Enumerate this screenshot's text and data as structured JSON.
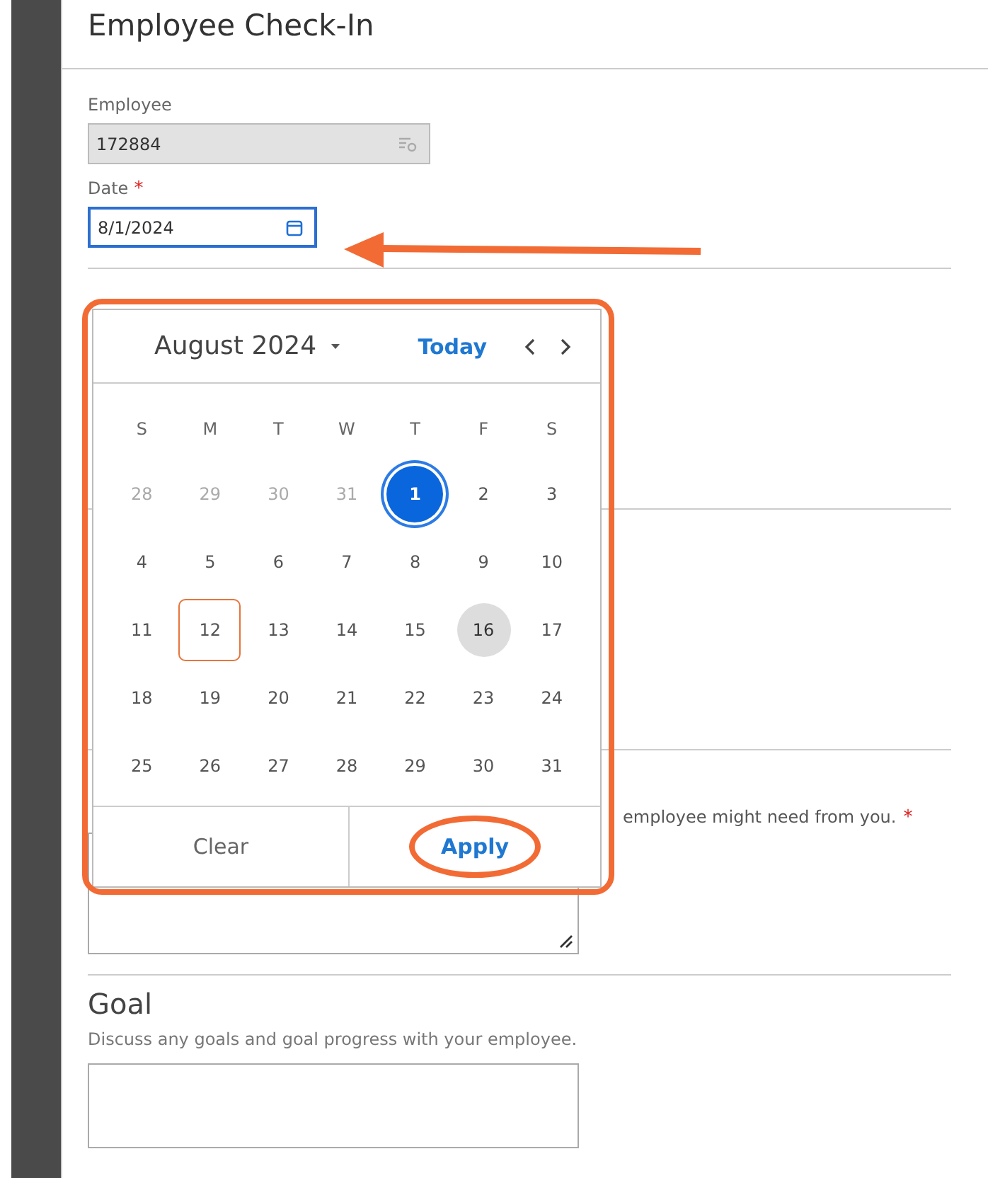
{
  "page": {
    "title": "Employee Check-In"
  },
  "fields": [
    {
      "label": "Employee",
      "value": "172884",
      "required": false,
      "disabled": true,
      "focused": false
    },
    {
      "label": "Date",
      "value": "8/1/2024",
      "required": true,
      "required_mark": "*",
      "disabled": false,
      "focused": true
    }
  ],
  "calendar": {
    "month_label": "August 2024",
    "today_label": "Today",
    "highlighted": true,
    "weekdays": [
      "S",
      "M",
      "T",
      "W",
      "T",
      "F",
      "S"
    ],
    "weeks": [
      [
        {
          "day": "28",
          "outside": true,
          "selected": false,
          "today": false,
          "marked": false
        },
        {
          "day": "29",
          "outside": true,
          "selected": false,
          "today": false,
          "marked": false
        },
        {
          "day": "30",
          "outside": true,
          "selected": false,
          "today": false,
          "marked": false
        },
        {
          "day": "31",
          "outside": true,
          "selected": false,
          "today": false,
          "marked": false
        },
        {
          "day": "1",
          "outside": false,
          "selected": true,
          "today": false,
          "marked": false
        },
        {
          "day": "2",
          "outside": false,
          "selected": false,
          "today": false,
          "marked": false
        },
        {
          "day": "3",
          "outside": false,
          "selected": false,
          "today": false,
          "marked": false
        }
      ],
      [
        {
          "day": "4",
          "outside": false,
          "selected": false,
          "today": false,
          "marked": false
        },
        {
          "day": "5",
          "outside": false,
          "selected": false,
          "today": false,
          "marked": false
        },
        {
          "day": "6",
          "outside": false,
          "selected": false,
          "today": false,
          "marked": false
        },
        {
          "day": "7",
          "outside": false,
          "selected": false,
          "today": false,
          "marked": false
        },
        {
          "day": "8",
          "outside": false,
          "selected": false,
          "today": false,
          "marked": false
        },
        {
          "day": "9",
          "outside": false,
          "selected": false,
          "today": false,
          "marked": false
        },
        {
          "day": "10",
          "outside": false,
          "selected": false,
          "today": false,
          "marked": false
        }
      ],
      [
        {
          "day": "11",
          "outside": false,
          "selected": false,
          "today": false,
          "marked": false
        },
        {
          "day": "12",
          "outside": false,
          "selected": false,
          "today": false,
          "marked": true
        },
        {
          "day": "13",
          "outside": false,
          "selected": false,
          "today": false,
          "marked": false
        },
        {
          "day": "14",
          "outside": false,
          "selected": false,
          "today": false,
          "marked": false
        },
        {
          "day": "15",
          "outside": false,
          "selected": false,
          "today": false,
          "marked": false
        },
        {
          "day": "16",
          "outside": false,
          "selected": false,
          "today": true,
          "marked": false
        },
        {
          "day": "17",
          "outside": false,
          "selected": false,
          "today": false,
          "marked": false
        }
      ],
      [
        {
          "day": "18",
          "outside": false,
          "selected": false,
          "today": false,
          "marked": false
        },
        {
          "day": "19",
          "outside": false,
          "selected": false,
          "today": false,
          "marked": false
        },
        {
          "day": "20",
          "outside": false,
          "selected": false,
          "today": false,
          "marked": false
        },
        {
          "day": "21",
          "outside": false,
          "selected": false,
          "today": false,
          "marked": false
        },
        {
          "day": "22",
          "outside": false,
          "selected": false,
          "today": false,
          "marked": false
        },
        {
          "day": "23",
          "outside": false,
          "selected": false,
          "today": false,
          "marked": false
        },
        {
          "day": "24",
          "outside": false,
          "selected": false,
          "today": false,
          "marked": false
        }
      ],
      [
        {
          "day": "25",
          "outside": false,
          "selected": false,
          "today": false,
          "marked": false
        },
        {
          "day": "26",
          "outside": false,
          "selected": false,
          "today": false,
          "marked": false
        },
        {
          "day": "27",
          "outside": false,
          "selected": false,
          "today": false,
          "marked": false
        },
        {
          "day": "28",
          "outside": false,
          "selected": false,
          "today": false,
          "marked": false
        },
        {
          "day": "29",
          "outside": false,
          "selected": false,
          "today": false,
          "marked": false
        },
        {
          "day": "30",
          "outside": false,
          "selected": false,
          "today": false,
          "marked": false
        },
        {
          "day": "31",
          "outside": false,
          "selected": false,
          "today": false,
          "marked": false
        }
      ]
    ],
    "buttons": [
      {
        "label": "Clear",
        "kind": "secondary",
        "highlighted": false
      },
      {
        "label": "Apply",
        "kind": "primary",
        "highlighted": true
      }
    ]
  },
  "annotations": {
    "arrow": true
  },
  "sections": [
    {
      "hint": "employee might need from you.",
      "required": true,
      "required_mark": "*"
    },
    {
      "heading": "Goal",
      "description": "Discuss any goals and goal progress with your employee."
    }
  ]
}
